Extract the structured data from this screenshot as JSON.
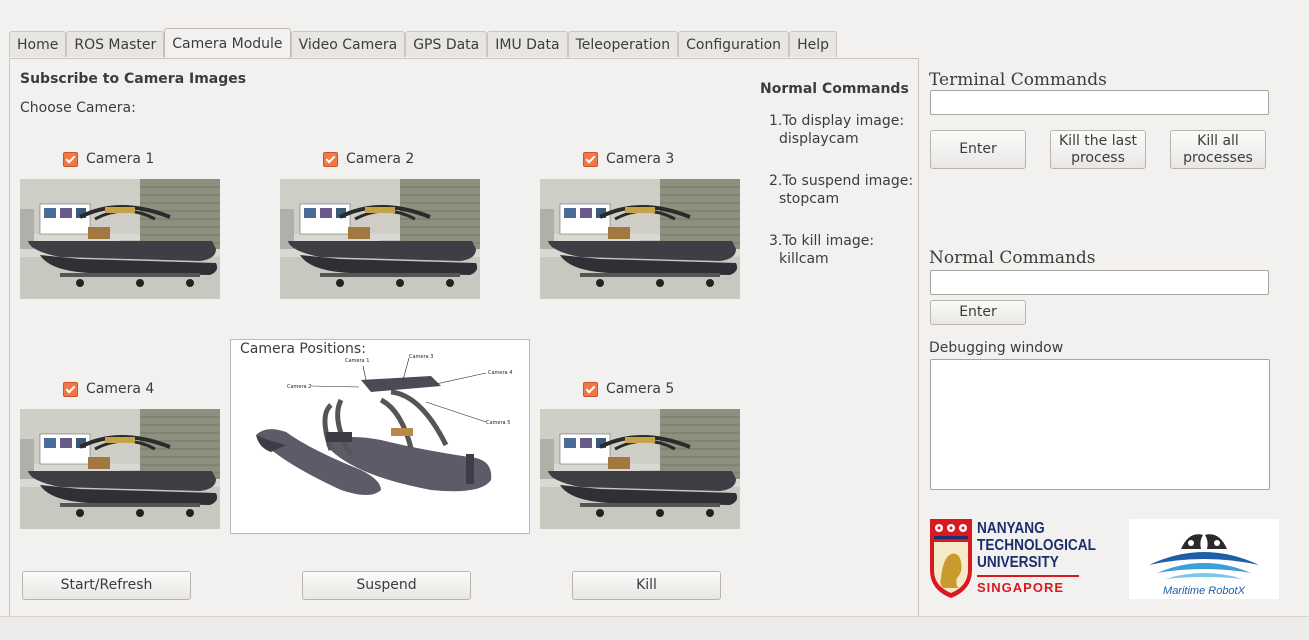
{
  "tabs": [
    "Home",
    "ROS Master",
    "Camera Module",
    "Video Camera",
    "GPS Data",
    "IMU Data",
    "Teleoperation",
    "Configuration",
    "Help"
  ],
  "active_tab": "Camera Module",
  "camera_module": {
    "heading": "Subscribe to Camera Images",
    "choose_label": "Choose Camera:",
    "cameras": [
      "Camera 1",
      "Camera 2",
      "Camera 3",
      "Camera 4",
      "Camera 5"
    ],
    "positions_label": "Camera Positions:",
    "diagram_labels": [
      "Camera 1",
      "Camera 2",
      "Camera 3",
      "Camera 4",
      "Camera 5"
    ],
    "buttons": {
      "start": "Start/Refresh",
      "suspend": "Suspend",
      "kill": "Kill"
    },
    "normal_commands_title": "Normal Commands",
    "commands": [
      {
        "line1": "1.To display image:",
        "line2": "displaycam"
      },
      {
        "line1": "2.To suspend image:",
        "line2": "stopcam"
      },
      {
        "line1": "3.To kill image:",
        "line2": "killcam"
      }
    ]
  },
  "right": {
    "terminal_title": "Terminal Commands",
    "enter_label": "Enter",
    "kill_last_1": "Kill the last",
    "kill_last_2": "process",
    "kill_all_1": "Kill all",
    "kill_all_2": "processes",
    "normal_title": "Normal Commands",
    "enter2_label": "Enter",
    "debug_title": "Debugging window"
  },
  "logos": {
    "ntu": [
      "NANYANG",
      "TECHNOLOGICAL",
      "UNIVERSITY",
      "SINGAPORE"
    ],
    "robotx": "Maritime RobotX"
  },
  "colors": {
    "checkbox": "#f07746",
    "ntu_red": "#d71920",
    "ntu_blue": "#1c2f6d",
    "robotx_blue": "#1f5fa8"
  }
}
